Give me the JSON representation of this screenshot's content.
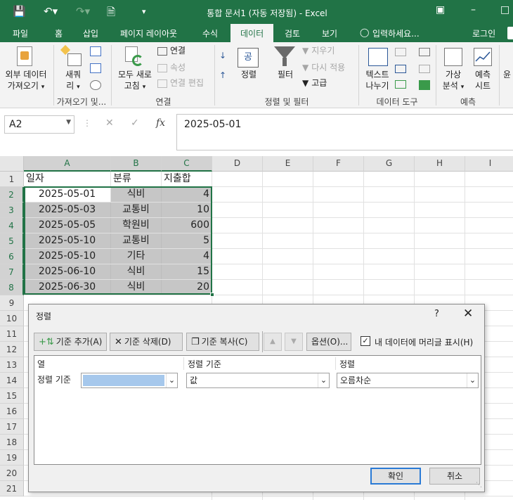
{
  "window": {
    "title": "통합 문서1 (자동 저장됨) - Excel"
  },
  "ribbon_tabs": [
    "파일",
    "홈",
    "삽입",
    "페이지 레이아웃",
    "수식",
    "데이터",
    "검토",
    "보기"
  ],
  "tell_me": "입력하세요...",
  "login": "로그인",
  "ribbon": {
    "get_external_line1": "외부 데이터",
    "get_external_line2": "가져오기",
    "new_query_line1": "새쿼",
    "new_query_line2": "리",
    "group_get_transform": "가져오기 및...",
    "refresh_all_line1": "모두 새로",
    "refresh_all_line2": "고침",
    "connections": "연결",
    "properties": "속성",
    "edit_links": "연결 편집",
    "group_connections": "연결",
    "sort_az": "공",
    "sort_label": "정렬",
    "filter": "필터",
    "clear": "지우기",
    "reapply": "다시 적용",
    "advanced": "고급",
    "group_sort_filter": "정렬 및 필터",
    "text_to_columns_line1": "텍스트",
    "text_to_columns_line2": "나누기",
    "group_data_tools": "데이터 도구",
    "whatif_line1": "가상",
    "whatif_line2": "분석",
    "forecast_line1": "예측",
    "forecast_line2": "시트",
    "group_forecast": "예측",
    "outline_partial": "윤"
  },
  "formula_bar": {
    "name_box": "A2",
    "fx": "fx",
    "value": "2025-05-01"
  },
  "grid": {
    "columns": [
      "A",
      "B",
      "C",
      "D",
      "E",
      "F",
      "G",
      "H",
      "I"
    ],
    "rows": [
      "1",
      "2",
      "3",
      "4",
      "5",
      "6",
      "7",
      "8",
      "9",
      "10",
      "11",
      "12",
      "13",
      "14",
      "15",
      "16",
      "17",
      "18",
      "19",
      "20",
      "21"
    ],
    "header": [
      "일자",
      "분류",
      "지출합"
    ],
    "data": [
      [
        "2025-05-01",
        "식비",
        "4"
      ],
      [
        "2025-05-03",
        "교통비",
        "10"
      ],
      [
        "2025-05-05",
        "학원비",
        "600"
      ],
      [
        "2025-05-10",
        "교통비",
        "5"
      ],
      [
        "2025-05-10",
        "기타",
        "4"
      ],
      [
        "2025-06-10",
        "식비",
        "15"
      ],
      [
        "2025-06-30",
        "식비",
        "20"
      ]
    ]
  },
  "sort_dialog": {
    "title": "정렬",
    "help": "?",
    "add_level": "기준 추가(A)",
    "delete_level": "기준 삭제(D)",
    "copy_level": "기준 복사(C)",
    "options": "옵션(O)...",
    "has_headers_label": "내 데이터에 머리글 표시(H)",
    "has_headers_checked": true,
    "col_header_column": "열",
    "col_header_sort_on": "정렬 기준",
    "col_header_order": "정렬",
    "row_label": "정렬 기준",
    "sort_on_value": "값",
    "order_value": "오름차순",
    "ok": "확인",
    "cancel": "취소"
  }
}
